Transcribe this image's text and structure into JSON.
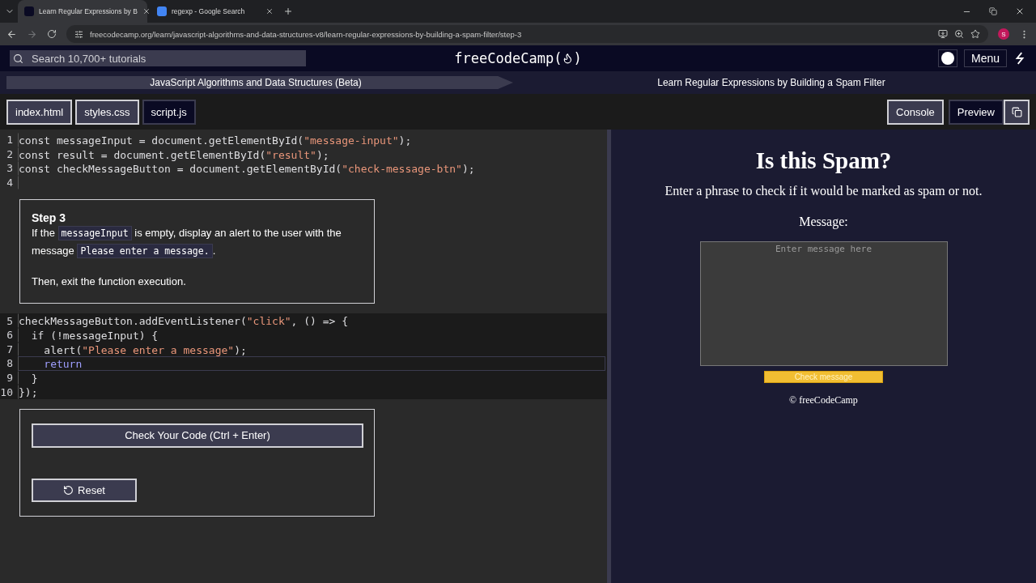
{
  "browser": {
    "tabs": [
      {
        "title": "Learn Regular Expressions by B",
        "selected": true
      },
      {
        "title": "regexp - Google Search",
        "selected": false
      }
    ],
    "url": "freecodecamp.org/learn/javascript-algorithms-and-data-structures-v8/learn-regular-expressions-by-building-a-spam-filter/step-3",
    "profile": "S"
  },
  "navbar": {
    "search_placeholder": "Search 10,700+ tutorials",
    "logo_start": "freeCodeCamp(",
    "logo_end": ")",
    "menu": "Menu"
  },
  "breadcrumb": {
    "superblock": "JavaScript Algorithms and Data Structures (Beta)",
    "block": "Learn Regular Expressions by Building a Spam Filter"
  },
  "file_tabs": [
    {
      "label": "index.html",
      "selected": false
    },
    {
      "label": "styles.css",
      "selected": false
    },
    {
      "label": "script.js",
      "selected": true
    }
  ],
  "panel_buttons": [
    {
      "label": "Console",
      "selected": false
    },
    {
      "label": "Preview",
      "selected": true
    }
  ],
  "editor": {
    "lines_top": [
      {
        "number": "1",
        "active": false,
        "tokens": [
          {
            "kind": "plain",
            "text": "const messageInput = document.getElementById("
          },
          {
            "kind": "string",
            "text": "\"message-input\""
          },
          {
            "kind": "plain",
            "text": ");"
          }
        ]
      },
      {
        "number": "2",
        "active": false,
        "tokens": [
          {
            "kind": "plain",
            "text": "const result = document.getElementById("
          },
          {
            "kind": "string",
            "text": "\"result\""
          },
          {
            "kind": "plain",
            "text": ");"
          }
        ]
      },
      {
        "number": "3",
        "active": false,
        "tokens": [
          {
            "kind": "plain",
            "text": "const checkMessageButton = document.getElementById("
          },
          {
            "kind": "string",
            "text": "\"check-message-btn\""
          },
          {
            "kind": "plain",
            "text": ");"
          }
        ]
      },
      {
        "number": "4",
        "active": false
      }
    ],
    "step": {
      "title": "Step 3",
      "paragraphs": [
        [
          {
            "kind": "text",
            "text": "If the "
          },
          {
            "kind": "code",
            "text": "messageInput"
          },
          {
            "kind": "text",
            "text": " is empty, display an alert to the user with the message "
          },
          {
            "kind": "code",
            "text": "Please enter a message."
          },
          {
            "kind": "text",
            "text": "."
          }
        ],
        [
          {
            "kind": "text",
            "text": "Then, exit the function execution."
          }
        ]
      ]
    },
    "lines_bottom": [
      {
        "number": "5",
        "active": false,
        "tokens": [
          {
            "kind": "plain",
            "text": "checkMessageButton.addEventListener("
          },
          {
            "kind": "string",
            "text": "\"click\""
          },
          {
            "kind": "plain",
            "text": ", () => {"
          }
        ]
      },
      {
        "number": "6",
        "active": false,
        "tokens": [
          {
            "kind": "plain",
            "text": "  if (!messageInput) {"
          }
        ]
      },
      {
        "number": "7",
        "active": false,
        "tokens": [
          {
            "kind": "plain",
            "text": "    alert("
          },
          {
            "kind": "string",
            "text": "\"Please enter a message\""
          },
          {
            "kind": "plain",
            "text": ");"
          }
        ]
      },
      {
        "number": "8",
        "active": true,
        "tokens": [
          {
            "kind": "keyword",
            "text": "    return"
          }
        ]
      },
      {
        "number": "9",
        "active": false,
        "tokens": [
          {
            "kind": "plain",
            "text": "  }"
          }
        ]
      },
      {
        "number": "10",
        "active": false,
        "tokens": [
          {
            "kind": "plain",
            "text": "});"
          }
        ]
      }
    ]
  },
  "actions": {
    "check": "Check Your Code (Ctrl + Enter)",
    "reset": "Reset"
  },
  "preview": {
    "title": "Is this Spam?",
    "description": "Enter a phrase to check if it would be marked as spam or not.",
    "label": "Message:",
    "placeholder": "Enter message here",
    "button": "Check message",
    "footer": "© freeCodeCamp"
  }
}
